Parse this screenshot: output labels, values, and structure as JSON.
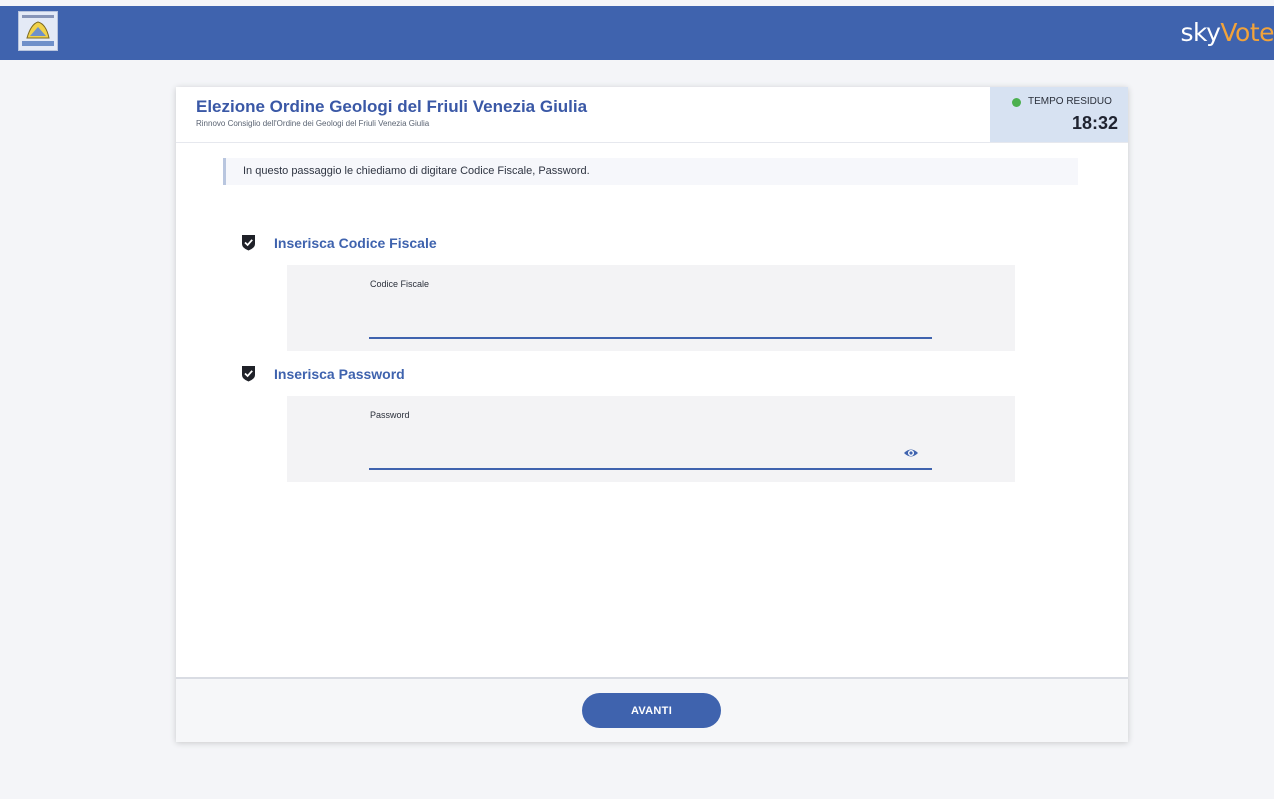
{
  "header": {
    "logo_icon": "geologists-order-crest-icon",
    "brand_prefix": "sky",
    "brand_suffix": "Vote"
  },
  "election": {
    "title": "Elezione Ordine Geologi del Friuli Venezia Giulia",
    "subtitle": "Rinnovo Consiglio dell'Ordine dei Geologi del Friuli Venezia Giulia"
  },
  "timer": {
    "label": "TEMPO RESIDUO",
    "value": "18:32",
    "status_color": "#4cb04f"
  },
  "instructions": "In questo passaggio le chiediamo di digitare Codice Fiscale, Password.",
  "fields": {
    "codice_fiscale": {
      "heading": "Inserisca Codice Fiscale",
      "label": "Codice Fiscale",
      "value": "",
      "icon": "check-shield-icon"
    },
    "password": {
      "heading": "Inserisca Password",
      "label": "Password",
      "value": "",
      "icon": "check-shield-icon",
      "toggle_icon": "eye-icon"
    }
  },
  "footer": {
    "next_label": "AVANTI"
  },
  "colors": {
    "primary": "#3f63ae",
    "brand_accent": "#f2a33a",
    "timer_background": "#d7e2f2"
  }
}
